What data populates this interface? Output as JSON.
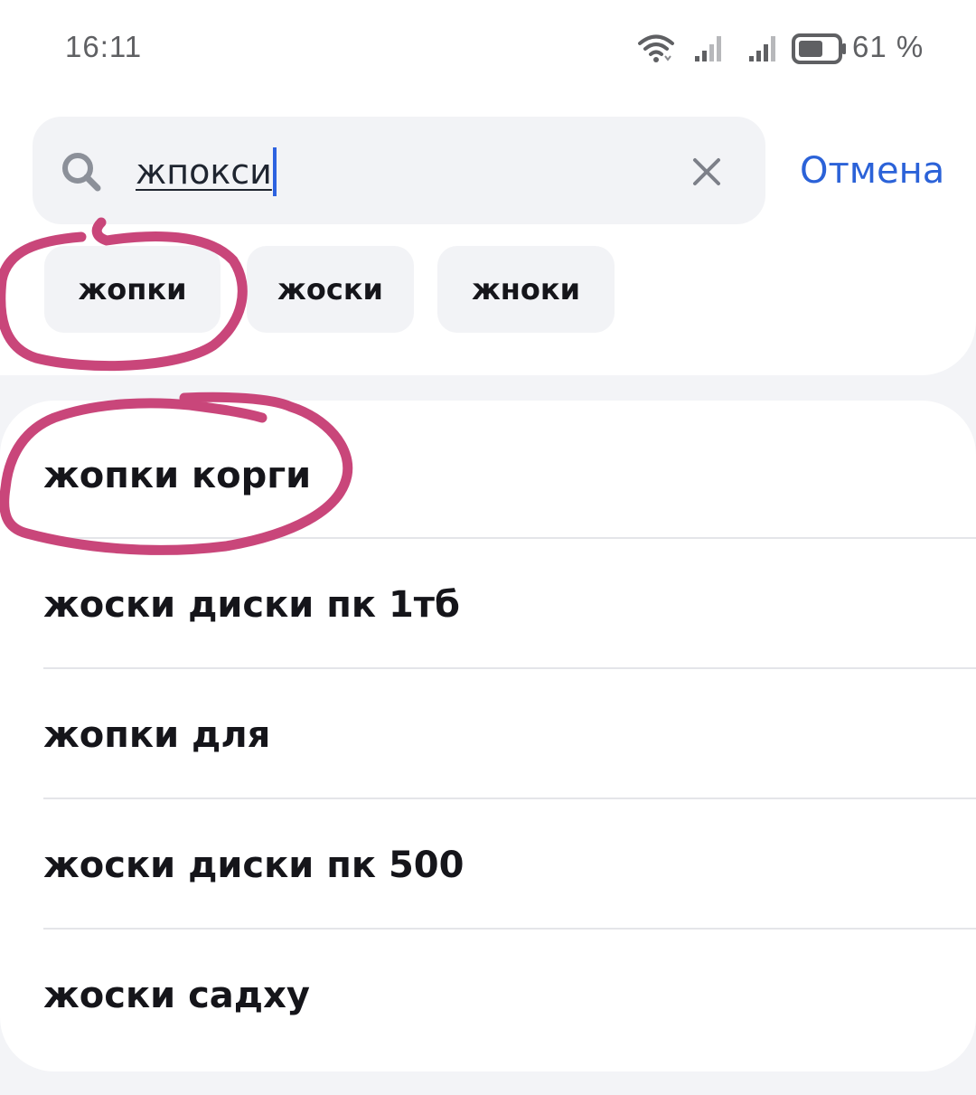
{
  "status_bar": {
    "time": "16:11",
    "battery": "61 %",
    "icons": [
      "wifi-icon",
      "cellular-signal-icon",
      "cellular-signal-icon",
      "battery-icon"
    ]
  },
  "search": {
    "query": "жпокси",
    "icon": "search-icon",
    "clear_icon": "close-icon",
    "cancel_label": "Отмена"
  },
  "chips": [
    {
      "label": "жопки"
    },
    {
      "label": "жоски"
    },
    {
      "label": "жноки"
    }
  ],
  "suggestions": [
    {
      "label": "жопки корги"
    },
    {
      "label": "жоски диски пк 1тб"
    },
    {
      "label": "жопки для"
    },
    {
      "label": "жоски диски пк 500"
    },
    {
      "label": "жоски садху"
    }
  ],
  "colors": {
    "accent": "#2b62d8",
    "caret": "#2d62e0",
    "annotation": "#c9467a",
    "background": "#f3f4f7",
    "surface": "#ffffff",
    "chip": "#f2f3f6"
  }
}
